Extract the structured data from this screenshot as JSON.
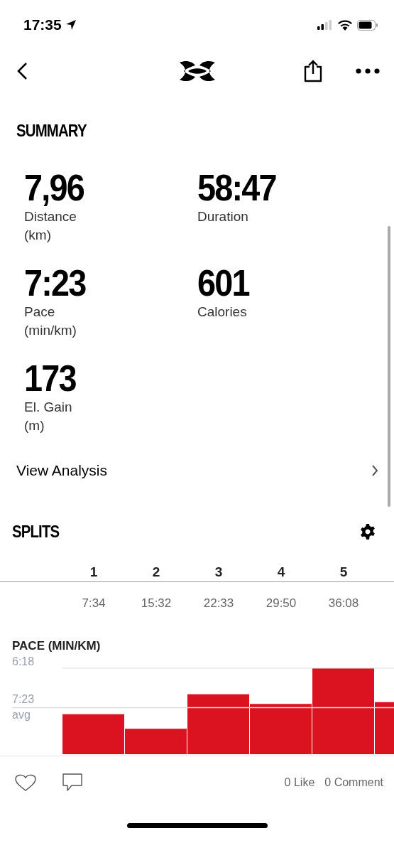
{
  "status_bar": {
    "time": "17:35"
  },
  "summary": {
    "title": "SUMMARY",
    "stats": [
      {
        "value": "7,96",
        "label": "Distance",
        "unit": "(km)"
      },
      {
        "value": "58:47",
        "label": "Duration"
      },
      {
        "value": "7:23",
        "label": "Pace",
        "unit": "(min/km)"
      },
      {
        "value": "601",
        "label": "Calories"
      },
      {
        "value": "173",
        "label": "El. Gain",
        "unit": "(m)"
      }
    ]
  },
  "view_analysis": {
    "label": "View Analysis"
  },
  "splits": {
    "title": "SPLITS",
    "columns": [
      {
        "number": "1",
        "time": "7:34"
      },
      {
        "number": "2",
        "time": "15:32"
      },
      {
        "number": "3",
        "time": "22:33"
      },
      {
        "number": "4",
        "time": "29:50"
      },
      {
        "number": "5",
        "time": "36:08"
      }
    ]
  },
  "pace_chart": {
    "title": "PACE (MIN/KM)",
    "top_label": "6:18",
    "avg_value": "7:23",
    "avg_label": "avg"
  },
  "social": {
    "likes": "0 Like",
    "comments": "0 Comment"
  }
}
